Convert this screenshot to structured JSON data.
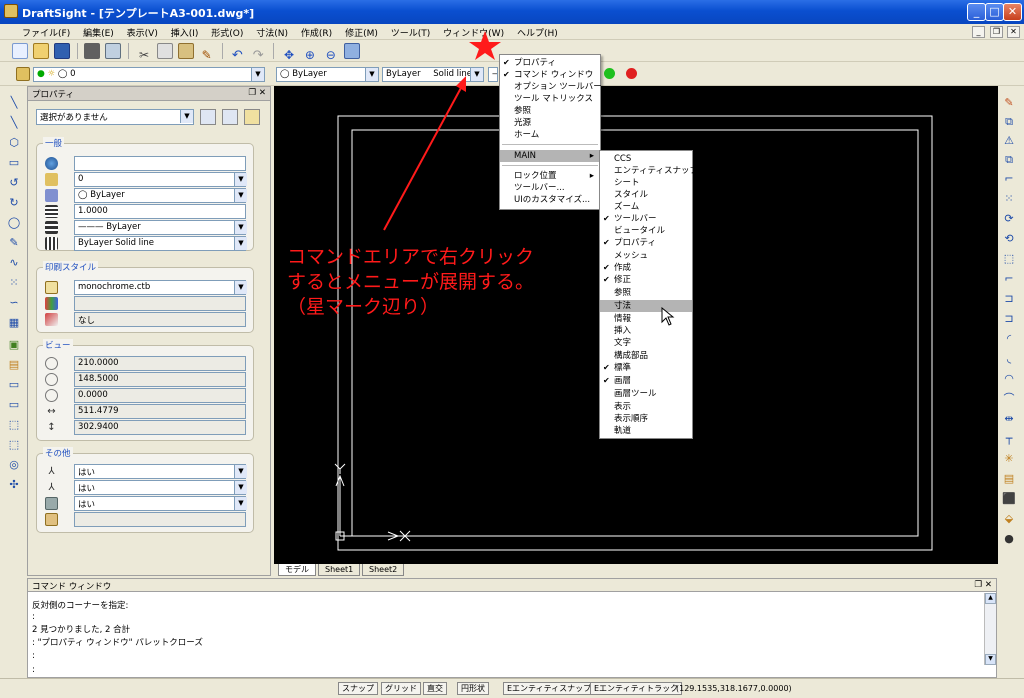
{
  "window": {
    "title": "DraftSight - [テンプレートA3-001.dwg*]",
    "minimize": "_",
    "maximize": "□",
    "close": "✕"
  },
  "menubar": [
    "ファイル(F)",
    "編集(E)",
    "表示(V)",
    "挿入(I)",
    "形式(O)",
    "寸法(N)",
    "作成(R)",
    "修正(M)",
    "ツール(T)",
    "ウィンドウ(W)",
    "ヘルプ(H)"
  ],
  "layer_toolbar": {
    "layer": "0",
    "color": "ByLayer",
    "linetype": "ByLayer",
    "linestyle": "Solid line"
  },
  "properties_panel": {
    "title": "プロパティ",
    "selection": "選択がありません",
    "general": {
      "label": "一般",
      "values": [
        "",
        "0",
        "ByLayer",
        "1.0000",
        "——— ByLayer",
        "ByLayer     Solid line"
      ]
    },
    "print_style": {
      "label": "印刷スタイル",
      "values": [
        "monochrome.ctb",
        "",
        "なし"
      ]
    },
    "view": {
      "label": "ビュー",
      "values": [
        "210.0000",
        "148.5000",
        "0.0000",
        "511.4779",
        "302.9400"
      ]
    },
    "misc": {
      "label": "その他",
      "values": [
        "はい",
        "はい",
        "はい",
        ""
      ]
    }
  },
  "layout_tabs": [
    "モデル",
    "Sheet1",
    "Sheet2"
  ],
  "command_window": {
    "title": "コマンド ウィンドウ",
    "lines": [
      "反対側のコーナーを指定:",
      ":",
      "2 見つかりました, 2 合計",
      ": \"プロパティ ウィンドウ\" パレットクローズ",
      ":",
      ":"
    ]
  },
  "context_menu": {
    "items": [
      {
        "label": "プロパティ",
        "checked": true
      },
      {
        "label": "コマンド ウィンドウ",
        "checked": true
      },
      {
        "label": "オプション ツールバー",
        "checked": false
      },
      {
        "label": "ツール マトリックス",
        "checked": false
      },
      {
        "label": "参照",
        "checked": false
      },
      {
        "label": "光源",
        "checked": false
      },
      {
        "label": "ホーム",
        "checked": false
      }
    ],
    "main": "MAIN",
    "tail": [
      "ロック位置",
      "ツールバー...",
      "UIのカスタマイズ..."
    ]
  },
  "submenu": {
    "items": [
      {
        "label": "CCS",
        "checked": false
      },
      {
        "label": "エンティティスナップ",
        "checked": false
      },
      {
        "label": "シート",
        "checked": false
      },
      {
        "label": "スタイル",
        "checked": false
      },
      {
        "label": "ズーム",
        "checked": false
      },
      {
        "label": "ツールバー",
        "checked": true
      },
      {
        "label": "ビュータイル",
        "checked": false
      },
      {
        "label": "プロパティ",
        "checked": true
      },
      {
        "label": "メッシュ",
        "checked": false
      },
      {
        "label": "作成",
        "checked": true
      },
      {
        "label": "修正",
        "checked": true
      },
      {
        "label": "参照",
        "checked": false
      },
      {
        "label": "寸法",
        "checked": false
      },
      {
        "label": "情報",
        "checked": false
      },
      {
        "label": "挿入",
        "checked": false
      },
      {
        "label": "文字",
        "checked": false
      },
      {
        "label": "構成部品",
        "checked": false
      },
      {
        "label": "標準",
        "checked": true
      },
      {
        "label": "画層",
        "checked": true
      },
      {
        "label": "画層ツール",
        "checked": false
      },
      {
        "label": "表示",
        "checked": false
      },
      {
        "label": "表示順序",
        "checked": false
      },
      {
        "label": "軌道",
        "checked": false
      }
    ],
    "highlighted_index": 12
  },
  "annotation": {
    "lines": [
      "コマンドエリアで右クリック",
      "するとメニューが展開する。",
      "（星マーク辺り）"
    ],
    "color": "#ff1a1a"
  },
  "status_bar": {
    "buttons": [
      "スナップ",
      "グリッド",
      "直交",
      "円形状",
      "Eエンティティスナップ",
      "Eエンティティトラック"
    ],
    "coords": "(129.1535,318.1677,0.0000)"
  }
}
